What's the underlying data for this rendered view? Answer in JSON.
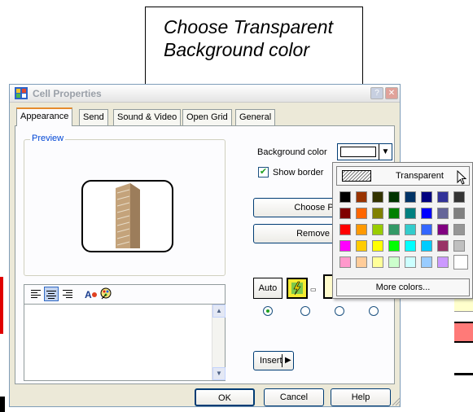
{
  "callout": {
    "line1": "Choose Transparent",
    "line2": "Background color"
  },
  "dialog": {
    "title": "Cell Properties",
    "help_btn": "?",
    "close_btn": "✕",
    "tabs": [
      "Appearance",
      "Send",
      "Sound & Video",
      "Open Grid",
      "General"
    ],
    "preview_label": "Preview",
    "background_color_label": "Background color",
    "show_border_label": "Show border",
    "show_border_checked": true,
    "choose_picture_label": "Choose Pict",
    "remove_picture_label": "Remove Pi",
    "auto_label": "Auto",
    "insert_label": "Insert",
    "ok_label": "OK",
    "cancel_label": "Cancel",
    "help_label": "Help"
  },
  "popup": {
    "transparent_label": "Transparent",
    "more_colors_label": "More colors...",
    "colors": [
      [
        "#000000",
        "#993300",
        "#333300",
        "#003300",
        "#003366",
        "#000080",
        "#333399",
        "#333333"
      ],
      [
        "#800000",
        "#ff6600",
        "#808000",
        "#008000",
        "#008080",
        "#0000ff",
        "#666699",
        "#808080"
      ],
      [
        "#ff0000",
        "#ff9900",
        "#99cc00",
        "#339966",
        "#33cccc",
        "#3366ff",
        "#800080",
        "#969696"
      ],
      [
        "#ff00ff",
        "#ffcc00",
        "#ffff00",
        "#00ff00",
        "#00ffff",
        "#00ccff",
        "#993366",
        "#c0c0c0"
      ],
      [
        "#ff99cc",
        "#ffcc99",
        "#ffff99",
        "#ccffcc",
        "#ccffff",
        "#99ccff",
        "#cc99ff",
        "#ffffff"
      ]
    ]
  },
  "colors": {
    "accent_tab": "#e68b2c",
    "group_label": "#0046d5"
  }
}
